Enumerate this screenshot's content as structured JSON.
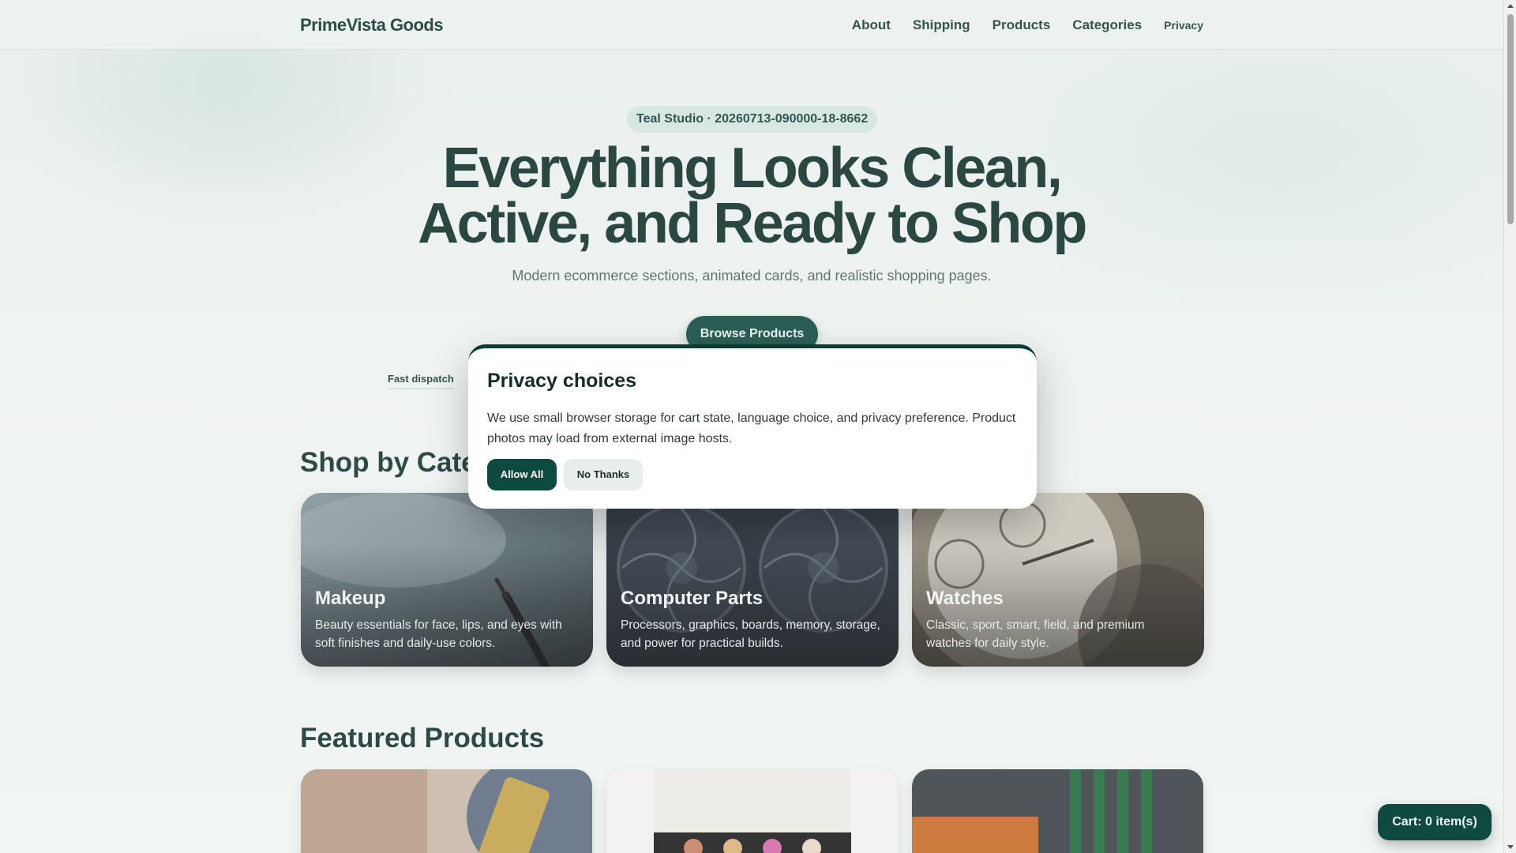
{
  "header": {
    "brand": "PrimeVista Goods",
    "nav": [
      {
        "label": "About"
      },
      {
        "label": "Shipping"
      },
      {
        "label": "Products"
      },
      {
        "label": "Categories"
      },
      {
        "label": "Privacy"
      }
    ]
  },
  "hero": {
    "badge": "Teal Studio · 20260713-090000-18-8662",
    "title_line1": "Everything Looks Clean,",
    "title_line2": "Active, and Ready to Shop",
    "subtitle": "Modern ecommerce sections, animated cards, and realistic shopping pages.",
    "cta": "Browse Products",
    "feature": "Fast dispatch"
  },
  "categories": {
    "title": "Shop by Categories",
    "items": [
      {
        "name": "Makeup",
        "desc": "Beauty essentials for face, lips, and eyes with soft finishes and daily-use colors."
      },
      {
        "name": "Computer Parts",
        "desc": "Processors, graphics, boards, memory, storage, and power for practical builds."
      },
      {
        "name": "Watches",
        "desc": "Classic, sport, smart, field, and premium watches for daily style."
      }
    ]
  },
  "featured": {
    "title": "Featured Products"
  },
  "privacy_modal": {
    "title": "Privacy choices",
    "text": "We use small browser storage for cart state, language choice, and privacy preference. Product photos may load from external image hosts.",
    "allow": "Allow All",
    "deny": "No Thanks"
  },
  "cart": {
    "label": "Cart: 0 item(s)"
  },
  "colors": {
    "accent": "#0f4a40",
    "text": "#14342f",
    "badge_bg": "#d3e5df"
  }
}
